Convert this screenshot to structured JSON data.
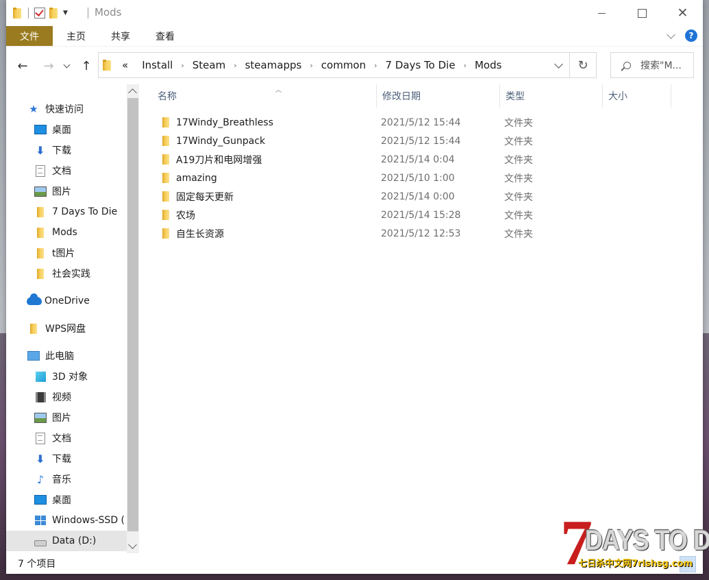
{
  "window": {
    "title": "Mods"
  },
  "ribbon": {
    "tabs": [
      "文件",
      "主页",
      "共享",
      "查看"
    ]
  },
  "address": {
    "overflow": "«",
    "crumbs": [
      "Install",
      "Steam",
      "steamapps",
      "common",
      "7 Days To Die",
      "Mods"
    ]
  },
  "search": {
    "placeholder": "搜索\"M..."
  },
  "nav": {
    "items": [
      {
        "label": "快速访问",
        "icon": "star-icon"
      },
      {
        "label": "桌面",
        "icon": "desktop-icon",
        "pinned": true
      },
      {
        "label": "下载",
        "icon": "download-icon",
        "pinned": true
      },
      {
        "label": "文档",
        "icon": "document-icon",
        "pinned": true
      },
      {
        "label": "图片",
        "icon": "pictures-icon",
        "pinned": true
      },
      {
        "label": "7 Days To Die",
        "icon": "folder-icon"
      },
      {
        "label": "Mods",
        "icon": "folder-icon"
      },
      {
        "label": "t图片",
        "icon": "folder-icon"
      },
      {
        "label": "社会实践",
        "icon": "folder-icon"
      },
      {
        "label": "OneDrive",
        "icon": "onedrive-cloud-icon"
      },
      {
        "label": "WPS网盘",
        "icon": "folder-icon"
      },
      {
        "label": "此电脑",
        "icon": "this-pc-icon"
      },
      {
        "label": "3D 对象",
        "icon": "3d-objects-icon"
      },
      {
        "label": "视频",
        "icon": "video-icon"
      },
      {
        "label": "图片",
        "icon": "pictures-icon"
      },
      {
        "label": "文档",
        "icon": "document-icon"
      },
      {
        "label": "下载",
        "icon": "download-icon"
      },
      {
        "label": "音乐",
        "icon": "music-icon"
      },
      {
        "label": "桌面",
        "icon": "desktop-icon"
      },
      {
        "label": "Windows-SSD (",
        "icon": "windows-drive-icon"
      },
      {
        "label": "Data (D:)",
        "icon": "drive-icon",
        "selected": true
      }
    ]
  },
  "columns": {
    "name": "名称",
    "date": "修改日期",
    "type": "类型",
    "size": "大小"
  },
  "files": [
    {
      "name": "17Windy_Breathless",
      "date": "2021/5/12 15:44",
      "type": "文件夹"
    },
    {
      "name": "17Windy_Gunpack",
      "date": "2021/5/12 15:44",
      "type": "文件夹"
    },
    {
      "name": "A19刀片和电网增强",
      "date": "2021/5/14 0:04",
      "type": "文件夹"
    },
    {
      "name": "amazing",
      "date": "2021/5/10 1:00",
      "type": "文件夹"
    },
    {
      "name": "固定每天更新",
      "date": "2021/5/14 0:00",
      "type": "文件夹"
    },
    {
      "name": "农场",
      "date": "2021/5/14 15:28",
      "type": "文件夹"
    },
    {
      "name": "自生长资源",
      "date": "2021/5/12 12:53",
      "type": "文件夹"
    }
  ],
  "status": {
    "count": "7 个项目"
  },
  "watermark": {
    "seven": "7",
    "title": "DAYS TO DIE",
    "sub": "七日杀中文网7rishsg.com"
  },
  "colors": {
    "file_tab": "#9a7b1f",
    "accent": "#1f73d6",
    "folder": "#f7cf5c",
    "logo_red": "#c81e1e"
  }
}
